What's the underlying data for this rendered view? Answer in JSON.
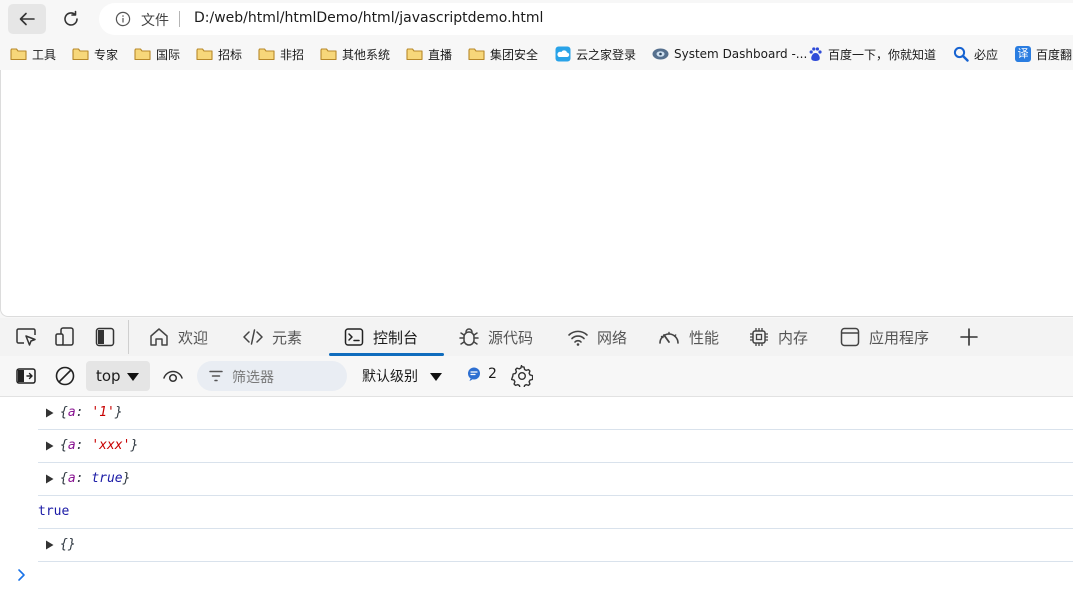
{
  "browser": {
    "address": {
      "scheme_label": "文件",
      "url": "D:/web/html/htmlDemo/html/javascriptdemo.html"
    }
  },
  "bookmarks": [
    {
      "label": "工具",
      "icon": "folder-icon"
    },
    {
      "label": "专家",
      "icon": "folder-icon"
    },
    {
      "label": "国际",
      "icon": "folder-icon"
    },
    {
      "label": "招标",
      "icon": "folder-icon"
    },
    {
      "label": "非招",
      "icon": "folder-icon"
    },
    {
      "label": "其他系统",
      "icon": "folder-icon"
    },
    {
      "label": "直播",
      "icon": "folder-icon"
    },
    {
      "label": "集团安全",
      "icon": "folder-icon"
    },
    {
      "label": "云之家登录",
      "icon": "cloud-icon"
    },
    {
      "label": "System Dashboard -...",
      "icon": "dashboard-icon"
    },
    {
      "label": "百度一下，你就知道",
      "icon": "baidu-icon"
    },
    {
      "label": "必应",
      "icon": "search-icon"
    },
    {
      "label": "百度翻",
      "icon": "translate-icon",
      "icon_text": "译"
    }
  ],
  "devtools": {
    "tabs": [
      {
        "label": "欢迎",
        "icon": "home-icon"
      },
      {
        "label": "元素",
        "icon": "code-icon"
      },
      {
        "label": "控制台",
        "icon": "console-icon",
        "active": true
      },
      {
        "label": "源代码",
        "icon": "bug-icon"
      },
      {
        "label": "网络",
        "icon": "wifi-icon"
      },
      {
        "label": "性能",
        "icon": "gauge-icon"
      },
      {
        "label": "内存",
        "icon": "chip-icon"
      },
      {
        "label": "应用程序",
        "icon": "app-icon"
      }
    ],
    "console_toolbar": {
      "context": "top",
      "filter_placeholder": "筛选器",
      "level": "默认级别",
      "message_count": "2"
    },
    "console_rows": [
      {
        "expandable": true,
        "key": "a",
        "value": "'1'",
        "value_type": "string"
      },
      {
        "expandable": true,
        "key": "a",
        "value": "'xxx'",
        "value_type": "string"
      },
      {
        "expandable": true,
        "key": "a",
        "value": "true",
        "value_type": "boolean"
      },
      {
        "expandable": false,
        "text": "true",
        "value_type": "boolean"
      },
      {
        "expandable": true,
        "text": "{}",
        "value_type": "object"
      }
    ]
  },
  "colors": {
    "accent": "#0f6cbd",
    "folder": "#f4c04e",
    "string": "#c80000",
    "keyword": "#881391",
    "boolean": "#1a1aa6"
  }
}
